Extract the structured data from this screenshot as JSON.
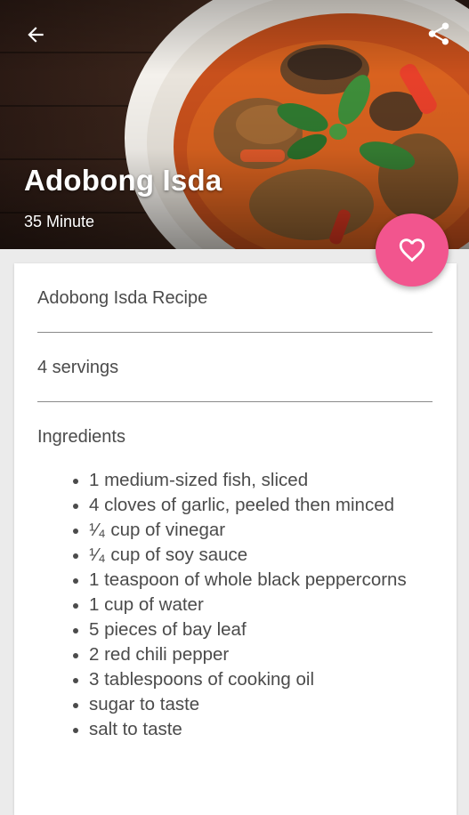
{
  "header": {
    "title": "Adobong Isda",
    "duration": "35 Minute"
  },
  "icons": {
    "back": "arrow-back-icon",
    "share": "share-icon",
    "favorite": "heart-outline-icon"
  },
  "colors": {
    "accent": "#f2558e",
    "card": "#ffffff",
    "background": "#ebebeb"
  },
  "card": {
    "recipe_name": "Adobong Isda Recipe",
    "servings": "4 servings",
    "ingredients_heading": "Ingredients",
    "ingredients": [
      "1 medium-sized fish, sliced",
      "4 cloves of garlic, peeled then minced",
      "¹⁄₄ cup of vinegar",
      "¹⁄₄ cup of soy sauce",
      "1 teaspoon of whole black peppercorns",
      "1 cup of water",
      "5 pieces of bay leaf",
      "2 red chili pepper",
      "3 tablespoons of cooking oil",
      "sugar to taste",
      "salt to taste"
    ]
  }
}
